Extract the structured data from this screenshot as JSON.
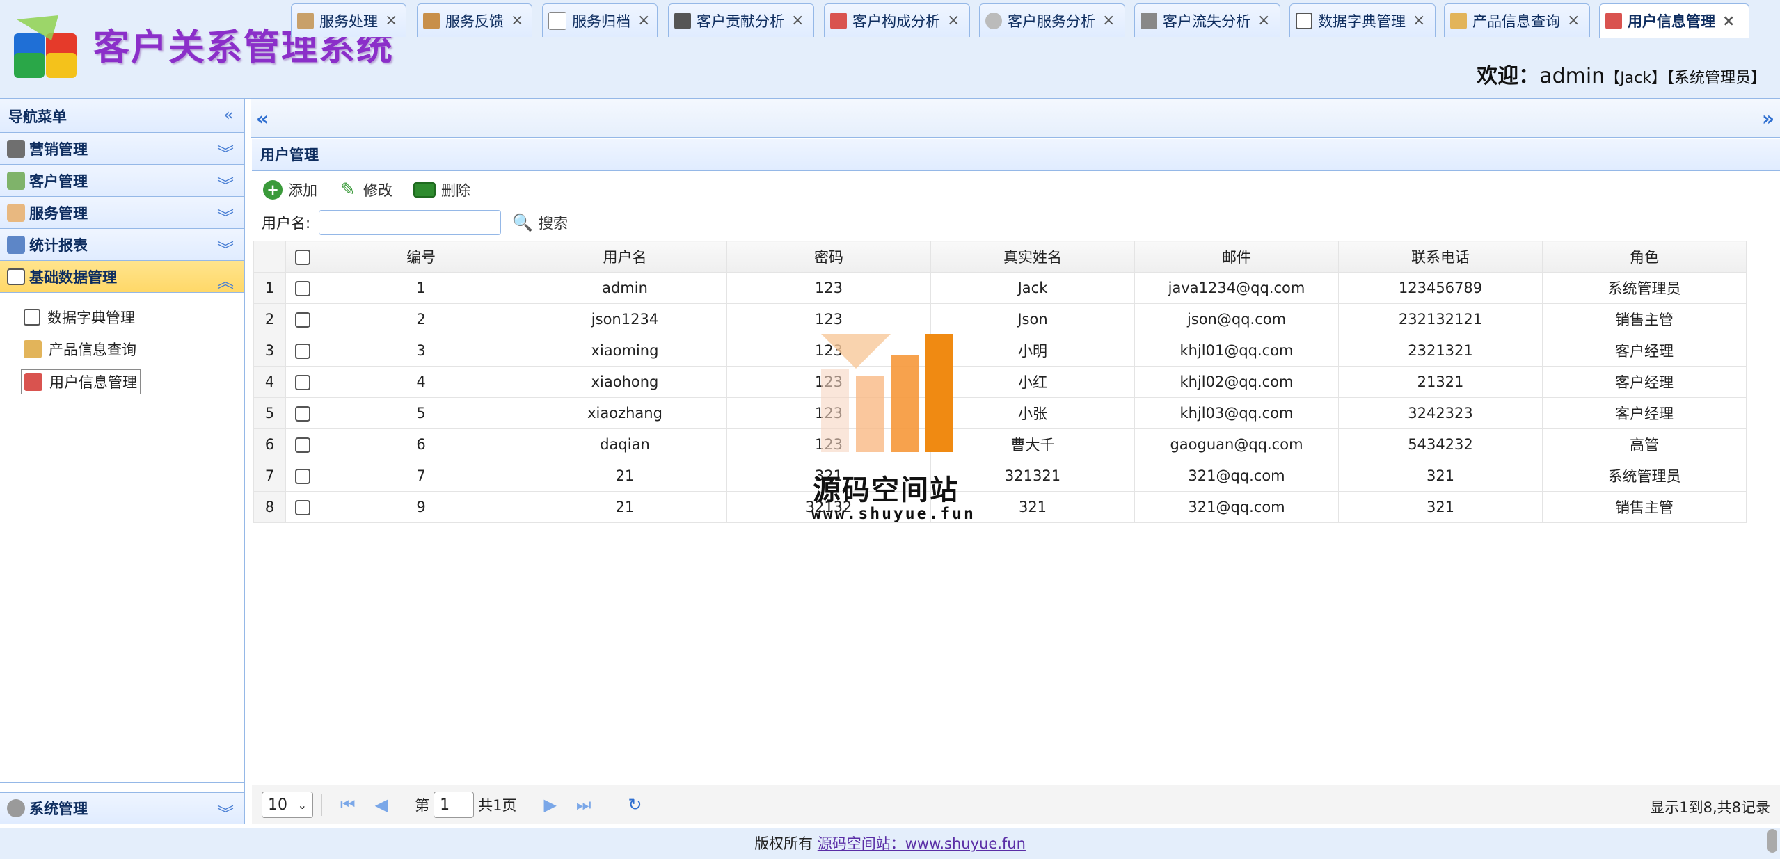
{
  "app": {
    "title": "客户关系管理系统",
    "welcome_label": "欢迎：",
    "user": "admin",
    "user_detail": "【Jack】【系统管理员】"
  },
  "sidebar": {
    "header": "导航菜单",
    "groups": [
      {
        "label": "营销管理",
        "icon": "marketing-icon"
      },
      {
        "label": "客户管理",
        "icon": "customer-icon"
      },
      {
        "label": "服务管理",
        "icon": "service-icon"
      },
      {
        "label": "统计报表",
        "icon": "report-icon"
      },
      {
        "label": "基础数据管理",
        "icon": "base-data-icon"
      }
    ],
    "sub_items": [
      {
        "label": "数据字典管理",
        "icon": "dictionary-icon"
      },
      {
        "label": "产品信息查询",
        "icon": "product-icon"
      },
      {
        "label": "用户信息管理",
        "icon": "user-icon"
      }
    ],
    "bottom_group": {
      "label": "系统管理",
      "icon": "gear-icon"
    }
  },
  "tabs": [
    {
      "label": "服务处理"
    },
    {
      "label": "服务反馈"
    },
    {
      "label": "服务归档"
    },
    {
      "label": "客户贡献分析"
    },
    {
      "label": "客户构成分析"
    },
    {
      "label": "客户服务分析"
    },
    {
      "label": "客户流失分析"
    },
    {
      "label": "数据字典管理"
    },
    {
      "label": "产品信息查询"
    },
    {
      "label": "用户信息管理"
    }
  ],
  "panel": {
    "title": "用户管理",
    "toolbar": {
      "add": "添加",
      "edit": "修改",
      "delete": "删除"
    },
    "search": {
      "label": "用户名:",
      "value": "",
      "button": "搜索"
    }
  },
  "table": {
    "columns": [
      "编号",
      "用户名",
      "密码",
      "真实姓名",
      "邮件",
      "联系电话",
      "角色"
    ],
    "rows": [
      {
        "n": "1",
        "cells": [
          "1",
          "admin",
          "123",
          "Jack",
          "java1234@qq.com",
          "123456789",
          "系统管理员"
        ]
      },
      {
        "n": "2",
        "cells": [
          "2",
          "json1234",
          "123",
          "Json",
          "json@qq.com",
          "232132121",
          "销售主管"
        ]
      },
      {
        "n": "3",
        "cells": [
          "3",
          "xiaoming",
          "123",
          "小明",
          "khjl01@qq.com",
          "2321321",
          "客户经理"
        ]
      },
      {
        "n": "4",
        "cells": [
          "4",
          "xiaohong",
          "123",
          "小红",
          "khjl02@qq.com",
          "21321",
          "客户经理"
        ]
      },
      {
        "n": "5",
        "cells": [
          "5",
          "xiaozhang",
          "123",
          "小张",
          "khjl03@qq.com",
          "3242323",
          "客户经理"
        ]
      },
      {
        "n": "6",
        "cells": [
          "6",
          "daqian",
          "123",
          "曹大千",
          "gaoguan@qq.com",
          "5434232",
          "高管"
        ]
      },
      {
        "n": "7",
        "cells": [
          "7",
          "21",
          "321",
          "321321",
          "321@qq.com",
          "321",
          "系统管理员"
        ]
      },
      {
        "n": "8",
        "cells": [
          "9",
          "21",
          "32132",
          "321",
          "321@qq.com",
          "321",
          "销售主管"
        ]
      }
    ]
  },
  "pager": {
    "page_size": "10",
    "page_prefix": "第",
    "page_value": "1",
    "page_suffix": "共1页",
    "info": "显示1到8,共8记录"
  },
  "watermark": {
    "text": "源码空间站",
    "url": "www.shuyue.fun"
  },
  "footer": {
    "prefix": "版权所有",
    "link": "源码空间站：www.shuyue.fun"
  }
}
